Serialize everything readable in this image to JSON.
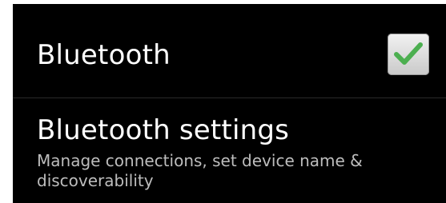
{
  "bluetooth": {
    "label": "Bluetooth",
    "checked": true,
    "check_color": "#4caf50"
  },
  "bluetooth_settings": {
    "label": "Bluetooth settings",
    "summary": "Manage connections, set device name & discoverability"
  },
  "colors": {
    "background": "#000000",
    "text": "#ffffff",
    "summary_text": "#bdbdbd"
  }
}
